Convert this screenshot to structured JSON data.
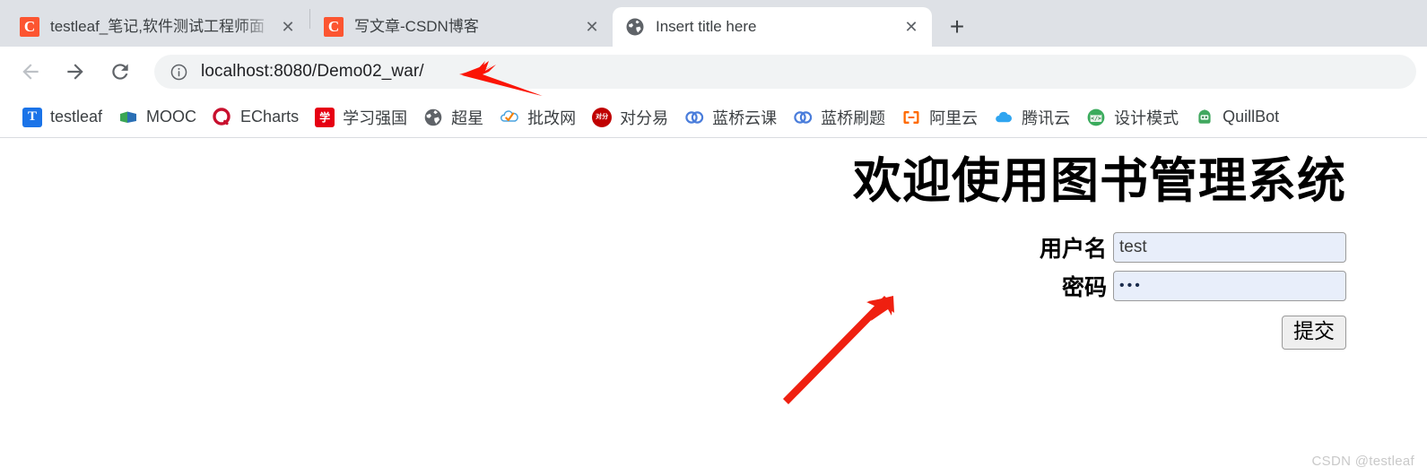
{
  "browser": {
    "tabs": [
      {
        "title": "testleaf_笔记,软件测试工程师面",
        "favicon": "csdn-favicon",
        "active": false,
        "close_label": "✕"
      },
      {
        "title": "写文章-CSDN博客",
        "favicon": "csdn-favicon",
        "active": false,
        "close_label": "✕"
      },
      {
        "title": "Insert title here",
        "favicon": "globe-favicon",
        "active": true,
        "close_label": "✕"
      }
    ],
    "new_tab_label": "+",
    "toolbar": {
      "back_icon": "back-arrow-icon",
      "forward_icon": "forward-arrow-icon",
      "reload_icon": "reload-icon",
      "site_info_icon": "info-circle-icon",
      "url": "localhost:8080/Demo02_war/"
    },
    "bookmarks": [
      {
        "label": "testleaf",
        "icon": "testleaf-icon",
        "color": "#1a73e8",
        "glyph": "T"
      },
      {
        "label": "MOOC",
        "icon": "mooc-icon",
        "color": "#34a853",
        "glyph": ""
      },
      {
        "label": "ECharts",
        "icon": "echarts-icon",
        "color": "#c8102e",
        "glyph": ""
      },
      {
        "label": "学习强国",
        "icon": "xuexiqiangguo-icon",
        "color": "#e60012",
        "glyph": "学"
      },
      {
        "label": "超星",
        "icon": "chaoxing-icon",
        "color": "#5f6368",
        "glyph": ""
      },
      {
        "label": "批改网",
        "icon": "pigai-icon",
        "color": "#f5820b",
        "glyph": ""
      },
      {
        "label": "对分易",
        "icon": "duifenyi-icon",
        "color": "#c00000",
        "glyph": ""
      },
      {
        "label": "蓝桥云课",
        "icon": "lanqiao-icon",
        "color": "#4a7ddb",
        "glyph": ""
      },
      {
        "label": "蓝桥刷题",
        "icon": "lanqiao-icon",
        "color": "#4a7ddb",
        "glyph": ""
      },
      {
        "label": "阿里云",
        "icon": "aliyun-icon",
        "color": "#ff6a00",
        "glyph": ""
      },
      {
        "label": "腾讯云",
        "icon": "tencentcloud-icon",
        "color": "#2fa5f0",
        "glyph": ""
      },
      {
        "label": "设计模式",
        "icon": "design-pattern-icon",
        "color": "#3aab5c",
        "glyph": ""
      },
      {
        "label": "QuillBot",
        "icon": "quillbot-icon",
        "color": "#3aab5c",
        "glyph": ""
      }
    ]
  },
  "page": {
    "title": "欢迎使用图书管理系统",
    "form": {
      "username_label": "用户名",
      "username_value": "test",
      "username_placeholder": "",
      "password_label": "密码",
      "password_value": "•••",
      "password_placeholder": "",
      "submit_label": "提交"
    },
    "watermark": "CSDN @testleaf"
  },
  "annotations": {
    "arrow_url_color": "#fb1405",
    "arrow_form_color": "#ef2010"
  }
}
